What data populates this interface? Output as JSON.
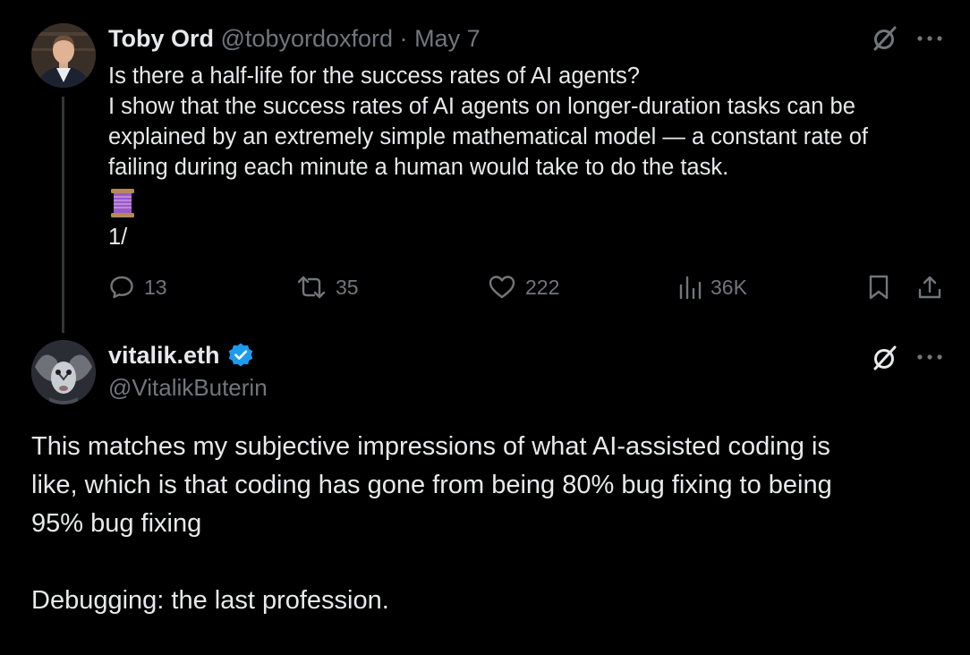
{
  "parent_tweet": {
    "author_name": "Toby Ord",
    "handle": "@tobyordoxford",
    "separator": "·",
    "date": "May 7",
    "lines": [
      "Is there a half-life for the success rates of AI agents?",
      "I show that the success rates of AI agents on longer-duration tasks can be",
      "explained by an extremely simple mathematical model — a constant rate of",
      "failing during each minute a human would take to do the task."
    ],
    "emoji_icon": "thread-spool-icon",
    "thread_count": "1/",
    "stats": {
      "replies": "13",
      "reposts": "35",
      "likes": "222",
      "views": "36K"
    }
  },
  "reply_tweet": {
    "author_name": "vitalik.eth",
    "verified_icon": "verified-badge-icon",
    "handle": "@VitalikButerin",
    "lines": [
      "This matches my subjective impressions of what AI-assisted coding is",
      "like, which is that coding has gone from being 80% bug fixing to being",
      "95% bug fixing"
    ],
    "closing_line": "Debugging: the last profession."
  },
  "colors": {
    "background": "#000000",
    "text": "#e7e9ea",
    "muted": "#71767b",
    "verified": "#1d9bf0",
    "thread_line": "#333639"
  }
}
